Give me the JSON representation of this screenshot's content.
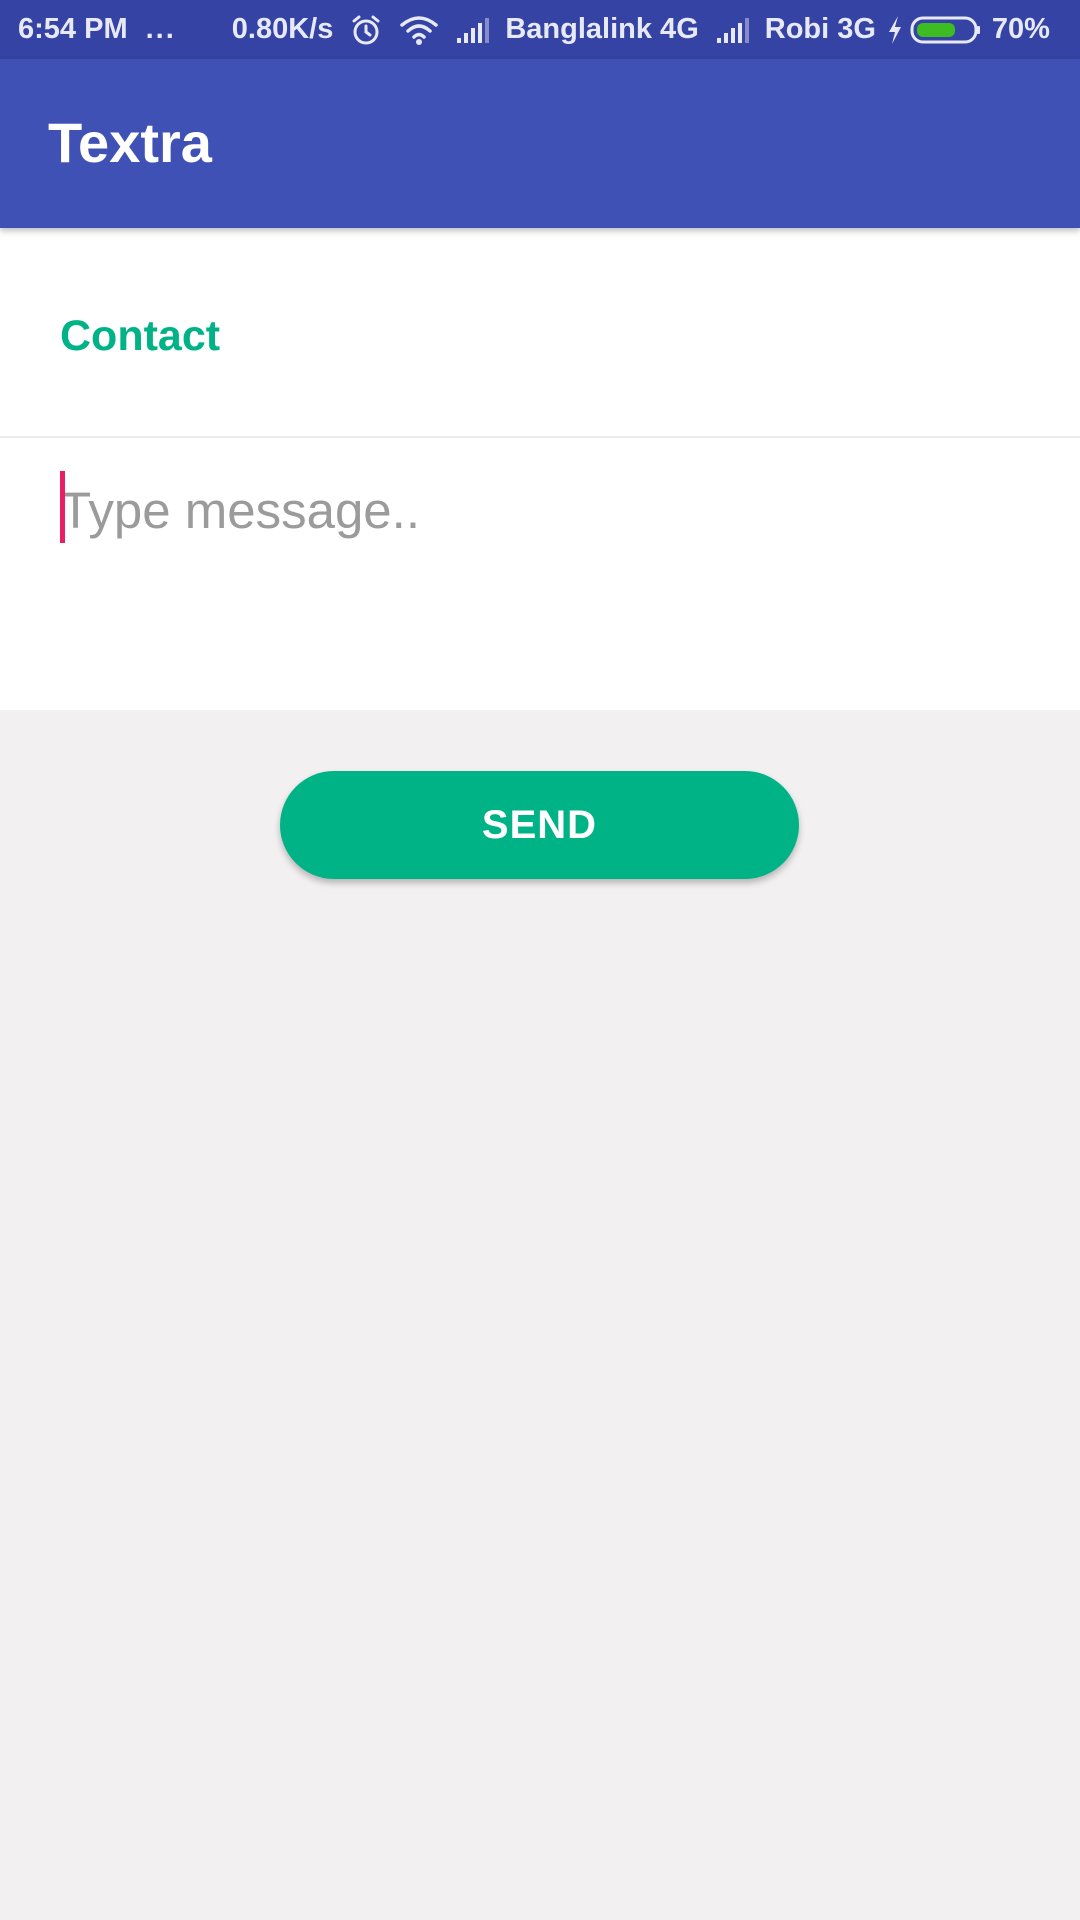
{
  "status_bar": {
    "time": "6:54 PM",
    "more_indicator": "...",
    "network_speed": "0.80K/s",
    "carrier_1": "Banglalink 4G",
    "carrier_2": "Robi 3G",
    "battery_percent": "70%",
    "battery_level": 0.7,
    "icons": [
      "alarm-icon",
      "wifi-icon",
      "signal-icon",
      "signal-icon",
      "charging-icon",
      "battery-icon"
    ]
  },
  "app_bar": {
    "title": "Textra"
  },
  "form": {
    "contact_label": "Contact",
    "message_placeholder": "Type message.."
  },
  "actions": {
    "send_label": "SEND"
  },
  "colors": {
    "primary": "#3f51b5",
    "primary_dark": "#3443a4",
    "accent": "#00b386",
    "cursor": "#e91e63",
    "background": "#f2f0f1"
  }
}
